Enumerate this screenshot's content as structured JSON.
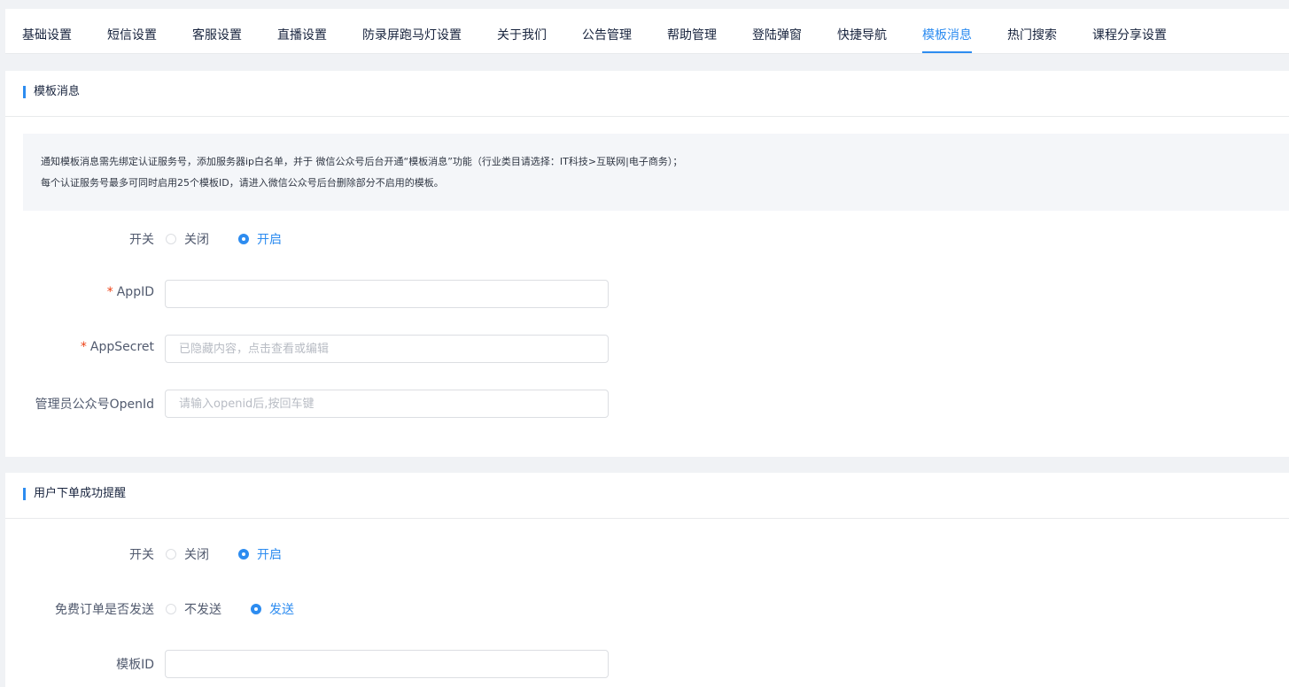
{
  "tabs": [
    {
      "label": "基础设置"
    },
    {
      "label": "短信设置"
    },
    {
      "label": "客服设置"
    },
    {
      "label": "直播设置"
    },
    {
      "label": "防录屏跑马灯设置"
    },
    {
      "label": "关于我们"
    },
    {
      "label": "公告管理"
    },
    {
      "label": "帮助管理"
    },
    {
      "label": "登陆弹窗"
    },
    {
      "label": "快捷导航"
    },
    {
      "label": "模板消息",
      "active": true
    },
    {
      "label": "热门搜索"
    },
    {
      "label": "课程分享设置"
    }
  ],
  "template_card": {
    "title": "模板消息",
    "notice": {
      "line1": "通知模板消息需先绑定认证服务号，添加服务器ip白名单，并于 微信公众号后台开通“模板消息”功能（行业类目请选择：IT科技>互联网|电子商务）；",
      "line2": "每个认证服务号最多可同时启用25个模板ID，请进入微信公众号后台删除部分不启用的模板。"
    },
    "switch": {
      "label": "开关",
      "off": "关闭",
      "on": "开启",
      "value": "on"
    },
    "appid": {
      "required": "*",
      "label": "AppID",
      "value": "",
      "placeholder": ""
    },
    "appsecret": {
      "required": "*",
      "label": "AppSecret",
      "value": "",
      "placeholder": "已隐藏内容，点击查看或编辑"
    },
    "admin_openid": {
      "label": "管理员公众号OpenId",
      "value": "",
      "placeholder": "请输入openid后,按回车键"
    }
  },
  "order_card": {
    "title": "用户下单成功提醒",
    "switch": {
      "label": "开关",
      "off": "关闭",
      "on": "开启",
      "value": "on"
    },
    "free_order": {
      "label": "免费订单是否发送",
      "off": "不发送",
      "on": "发送",
      "value": "on"
    },
    "template_id": {
      "label": "模板ID",
      "value": "",
      "placeholder": ""
    }
  },
  "colors": {
    "accent": "#2d8cf0",
    "required": "#ed4014",
    "background": "#f0f2f5"
  }
}
